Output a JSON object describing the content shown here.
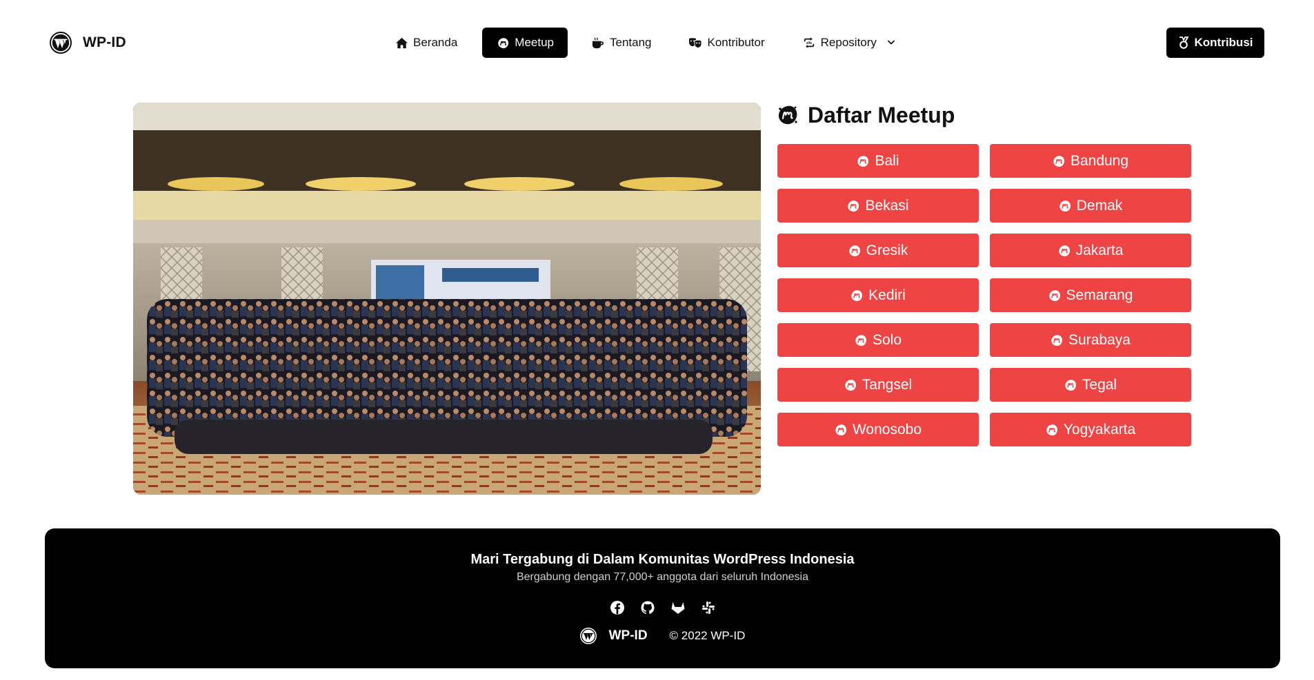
{
  "brand": {
    "name": "WP-ID"
  },
  "nav": {
    "items": [
      {
        "label": "Beranda",
        "icon": "home-icon"
      },
      {
        "label": "Meetup",
        "icon": "meetup-icon",
        "active": true
      },
      {
        "label": "Tentang",
        "icon": "coffee-icon"
      },
      {
        "label": "Kontributor",
        "icon": "masks-icon"
      },
      {
        "label": "Repository",
        "icon": "repo-icon",
        "dropdown": true
      }
    ]
  },
  "cta": {
    "label": "Kontribusi",
    "icon": "medal-icon"
  },
  "meetups": {
    "title": "Daftar Meetup",
    "cities": [
      "Bali",
      "Bandung",
      "Bekasi",
      "Demak",
      "Gresik",
      "Jakarta",
      "Kediri",
      "Semarang",
      "Solo",
      "Surabaya",
      "Tangsel",
      "Tegal",
      "Wonosobo",
      "Yogyakarta"
    ]
  },
  "footer": {
    "title": "Mari Tergabung di Dalam Komunitas WordPress Indonesia",
    "subtitle": "Bergabung dengan 77,000+ anggota dari seluruh Indonesia",
    "socials": [
      "facebook-icon",
      "github-icon",
      "gitlab-icon",
      "slack-icon"
    ],
    "brand": "WP-ID",
    "copyright": "© 2022 WP-ID"
  },
  "colors": {
    "accent": "#ee4444",
    "dark": "#000000",
    "background": "#ffffff"
  }
}
